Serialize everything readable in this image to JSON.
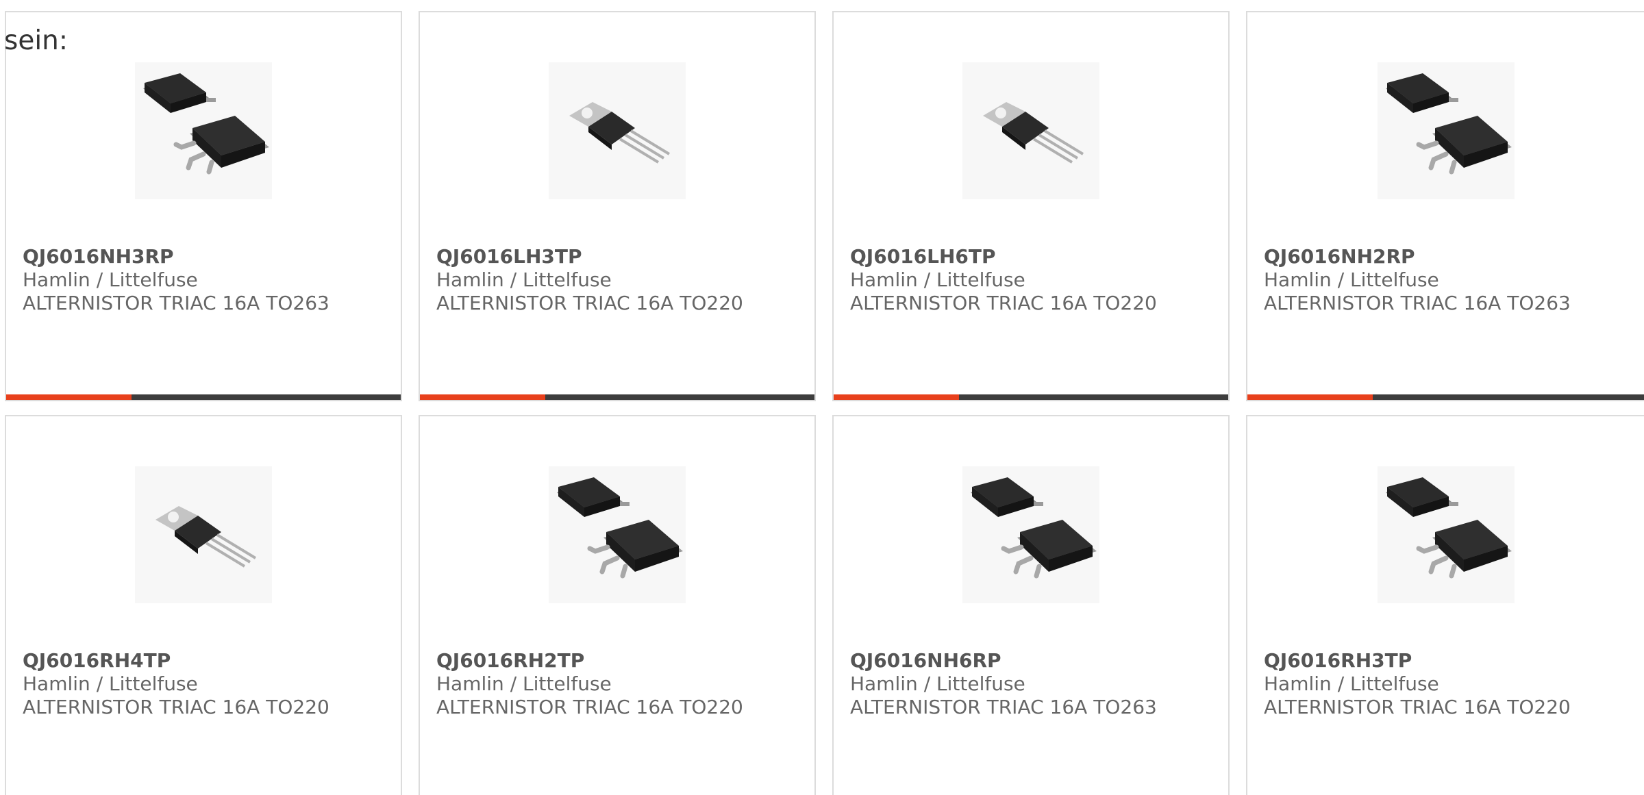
{
  "intro_text": "sein:",
  "colors": {
    "accent": "#e8401c",
    "bar": "#3d3d3d",
    "border": "#dcdcdc",
    "text": "#666666"
  },
  "products": [
    {
      "part": "QJ6016NH3RP",
      "maker": "Hamlin / Littelfuse",
      "desc": "ALTERNISTOR TRIAC 16A TO263",
      "image": "to263-package"
    },
    {
      "part": "QJ6016LH3TP",
      "maker": "Hamlin / Littelfuse",
      "desc": "ALTERNISTOR TRIAC 16A TO220",
      "image": "to220-package"
    },
    {
      "part": "QJ6016LH6TP",
      "maker": "Hamlin / Littelfuse",
      "desc": "ALTERNISTOR TRIAC 16A TO220",
      "image": "to220-package"
    },
    {
      "part": "QJ6016NH2RP",
      "maker": "Hamlin / Littelfuse",
      "desc": "ALTERNISTOR TRIAC 16A TO263",
      "image": "to263-package"
    },
    {
      "part": "QJ6016RH4TP",
      "maker": "Hamlin / Littelfuse",
      "desc": "ALTERNISTOR TRIAC 16A TO220",
      "image": "to220-package"
    },
    {
      "part": "QJ6016RH2TP",
      "maker": "Hamlin / Littelfuse",
      "desc": "ALTERNISTOR TRIAC 16A TO220",
      "image": "to263-package"
    },
    {
      "part": "QJ6016NH6RP",
      "maker": "Hamlin / Littelfuse",
      "desc": "ALTERNISTOR TRIAC 16A TO263",
      "image": "to263-package"
    },
    {
      "part": "QJ6016RH3TP",
      "maker": "Hamlin / Littelfuse",
      "desc": "ALTERNISTOR TRIAC 16A TO220",
      "image": "to263-package"
    }
  ]
}
